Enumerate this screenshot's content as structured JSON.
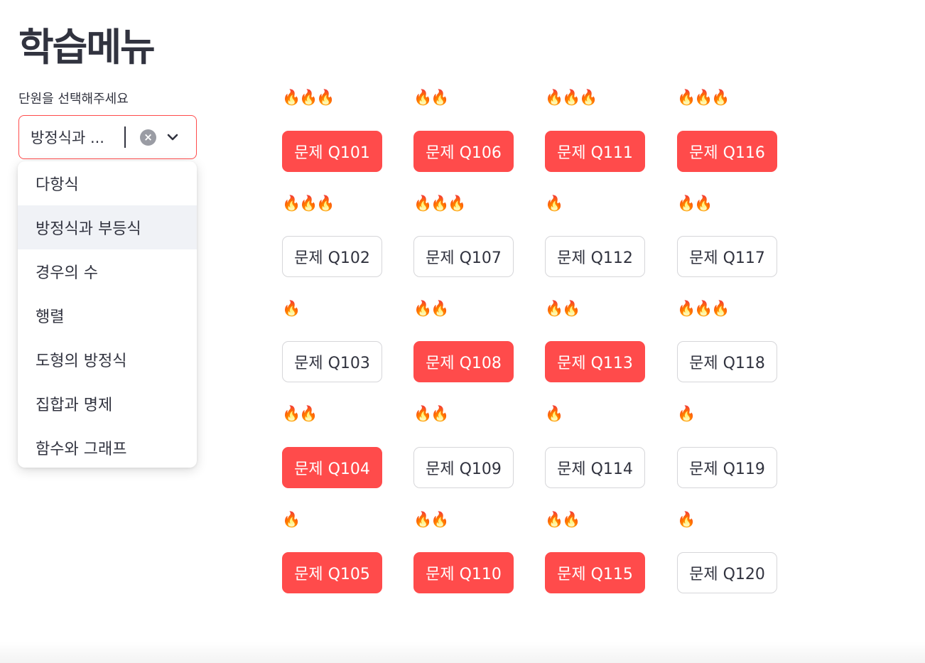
{
  "page": {
    "title": "학습메뉴"
  },
  "unit_select": {
    "label": "단원을 선택해주세요",
    "value": "방정식과 ...",
    "clear_symbol": "×"
  },
  "dropdown": {
    "options": [
      "다항식",
      "방정식과 부등식",
      "경우의 수",
      "행렬",
      "도형의 방정식",
      "집합과 명제",
      "함수와 그래프"
    ],
    "highlighted_index": 1
  },
  "colors": {
    "accent": "#ff4b4b",
    "text": "#31333f",
    "highlight": "#f0f2f6"
  },
  "problems": {
    "columns": [
      [
        {
          "label": "문제 Q101",
          "flames": "🔥🔥🔥",
          "state": "done"
        },
        {
          "label": "문제 Q102",
          "flames": "🔥🔥🔥",
          "state": "open"
        },
        {
          "label": "문제 Q103",
          "flames": "🔥",
          "state": "open"
        },
        {
          "label": "문제 Q104",
          "flames": "🔥🔥",
          "state": "done"
        },
        {
          "label": "문제 Q105",
          "flames": "🔥",
          "state": "done"
        }
      ],
      [
        {
          "label": "문제 Q106",
          "flames": "🔥🔥",
          "state": "done"
        },
        {
          "label": "문제 Q107",
          "flames": "🔥🔥🔥",
          "state": "open"
        },
        {
          "label": "문제 Q108",
          "flames": "🔥🔥",
          "state": "done"
        },
        {
          "label": "문제 Q109",
          "flames": "🔥🔥",
          "state": "open"
        },
        {
          "label": "문제 Q110",
          "flames": "🔥🔥",
          "state": "done"
        }
      ],
      [
        {
          "label": "문제 Q111",
          "flames": "🔥🔥🔥",
          "state": "done"
        },
        {
          "label": "문제 Q112",
          "flames": "🔥",
          "state": "open"
        },
        {
          "label": "문제 Q113",
          "flames": "🔥🔥",
          "state": "done"
        },
        {
          "label": "문제 Q114",
          "flames": "🔥",
          "state": "open"
        },
        {
          "label": "문제 Q115",
          "flames": "🔥🔥",
          "state": "done"
        }
      ],
      [
        {
          "label": "문제 Q116",
          "flames": "🔥🔥🔥",
          "state": "done"
        },
        {
          "label": "문제 Q117",
          "flames": "🔥🔥",
          "state": "open"
        },
        {
          "label": "문제 Q118",
          "flames": "🔥🔥🔥",
          "state": "open"
        },
        {
          "label": "문제 Q119",
          "flames": "🔥",
          "state": "open"
        },
        {
          "label": "문제 Q120",
          "flames": "🔥",
          "state": "open"
        }
      ]
    ]
  }
}
